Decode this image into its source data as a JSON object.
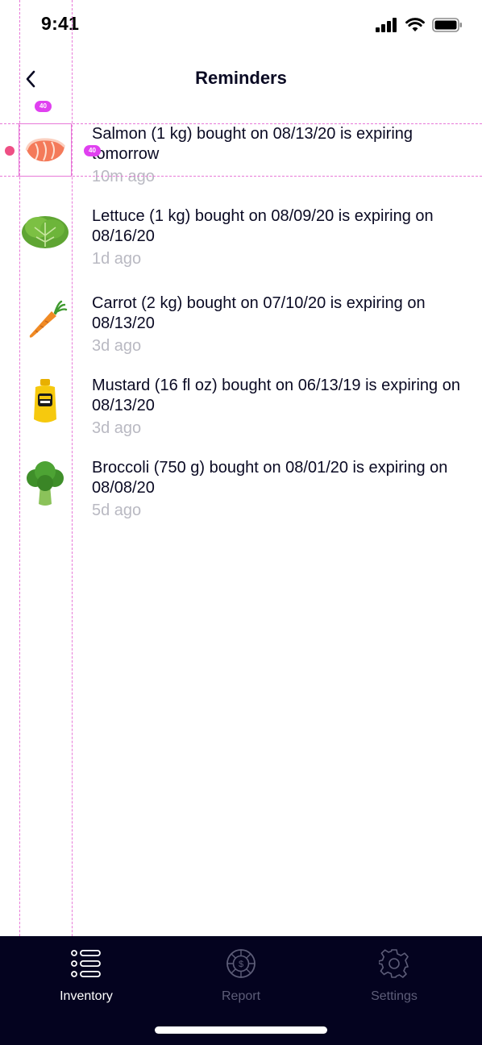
{
  "status_bar": {
    "time": "9:41",
    "icons": [
      "cellular-signal-icon",
      "wifi-icon",
      "battery-icon"
    ]
  },
  "nav": {
    "back_icon": "chevron-left-icon",
    "title": "Reminders"
  },
  "reminders": [
    {
      "icon": "salmon",
      "text": "Salmon (1 kg) bought on 08/13/20 is expiring tomorrow",
      "time": "10m ago",
      "unread": true
    },
    {
      "icon": "lettuce",
      "text": "Lettuce (1 kg) bought on 08/09/20 is expiring on 08/16/20",
      "time": "1d ago",
      "unread": false
    },
    {
      "icon": "carrot",
      "text": "Carrot (2 kg) bought on 07/10/20 is expiring on 08/13/20",
      "time": "3d ago",
      "unread": false
    },
    {
      "icon": "mustard",
      "text": "Mustard (16 fl oz) bought on 06/13/19 is expiring on 08/13/20",
      "time": "3d ago",
      "unread": false
    },
    {
      "icon": "broccoli",
      "text": "Broccoli (750 g) bought on 08/01/20 is expiring on 08/08/20",
      "time": "5d ago",
      "unread": false
    }
  ],
  "overlay": {
    "badge_top": "40",
    "badge_side": "40"
  },
  "tabs": [
    {
      "label": "Inventory",
      "icon": "list-icon",
      "active": true
    },
    {
      "label": "Report",
      "icon": "dollar-coin-icon",
      "active": false
    },
    {
      "label": "Settings",
      "icon": "gear-icon",
      "active": false
    }
  ],
  "colors": {
    "tab_bar_bg": "#04031f",
    "active_tab": "#ffffff",
    "inactive_tab": "#5d5d78",
    "timestamp": "#b9b9c2",
    "unread_dot": "#ee4f84",
    "guide": "#e879d8"
  }
}
